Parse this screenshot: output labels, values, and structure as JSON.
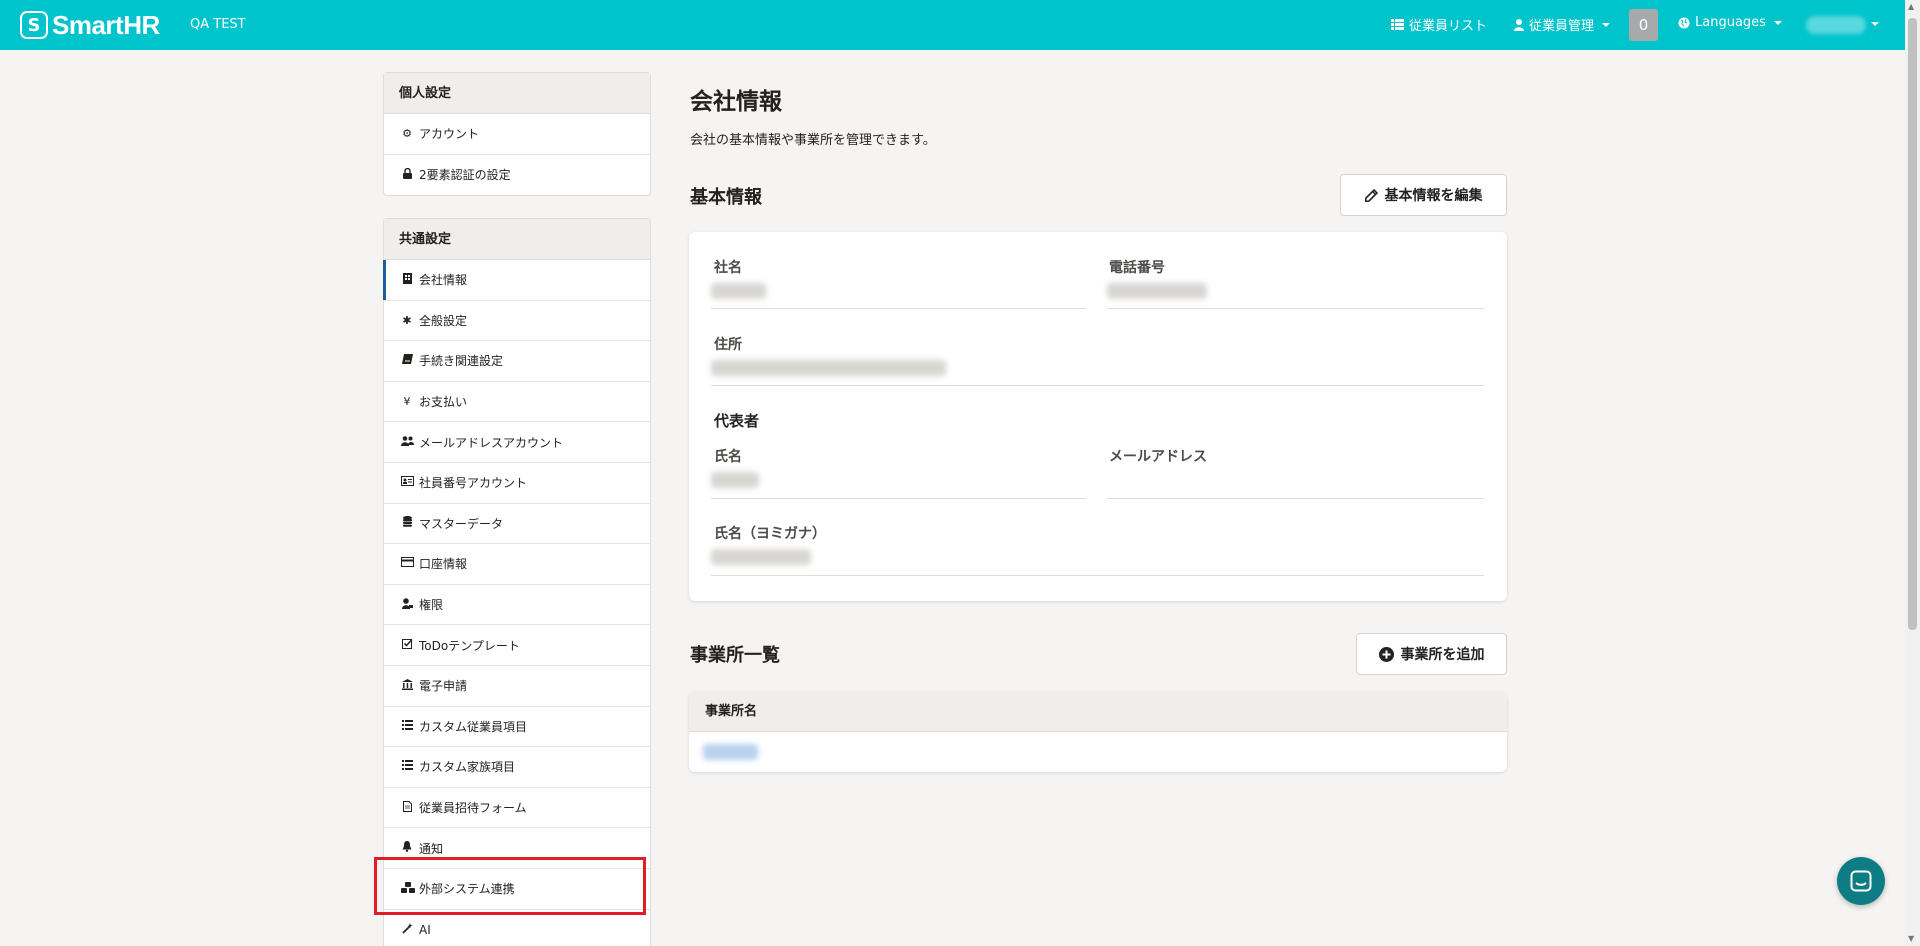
{
  "header": {
    "logo_text": "SmartHR",
    "logo_mark": "S",
    "tenant": "QA TEST",
    "nav": {
      "employee_list": "従業員リスト",
      "employee_manage": "従業員管理",
      "notifications_count": "0",
      "languages": "Languages"
    }
  },
  "sidebar": {
    "personal": {
      "title": "個人設定",
      "items": [
        {
          "label": "アカウント",
          "icon": "gear-icon"
        },
        {
          "label": "2要素認証の設定",
          "icon": "lock-icon"
        }
      ]
    },
    "common": {
      "title": "共通設定",
      "items": [
        {
          "label": "会社情報",
          "icon": "building-icon"
        },
        {
          "label": "全般設定",
          "icon": "asterisk-icon"
        },
        {
          "label": "手続き関連設定",
          "icon": "book-icon"
        },
        {
          "label": "お支払い",
          "icon": "yen-icon"
        },
        {
          "label": "メールアドレスアカウント",
          "icon": "users-icon"
        },
        {
          "label": "社員番号アカウント",
          "icon": "id-card-icon"
        },
        {
          "label": "マスターデータ",
          "icon": "database-icon"
        },
        {
          "label": "口座情報",
          "icon": "credit-card-icon"
        },
        {
          "label": "権限",
          "icon": "user-lock-icon"
        },
        {
          "label": "ToDoテンプレート",
          "icon": "checkbox-icon"
        },
        {
          "label": "電子申請",
          "icon": "bank-icon"
        },
        {
          "label": "カスタム従業員項目",
          "icon": "list-icon"
        },
        {
          "label": "カスタム家族項目",
          "icon": "list-icon"
        },
        {
          "label": "従業員招待フォーム",
          "icon": "file-icon"
        },
        {
          "label": "通知",
          "icon": "bell-icon"
        },
        {
          "label": "外部システム連携",
          "icon": "cubes-icon"
        },
        {
          "label": "AI",
          "icon": "magic-wand-icon"
        }
      ]
    }
  },
  "main": {
    "title": "会社情報",
    "description": "会社の基本情報や事業所を管理できます。",
    "basic_info": {
      "title": "基本情報",
      "edit_button": "基本情報を編集",
      "company_name_label": "社名",
      "phone_label": "電話番号",
      "address_label": "住所",
      "representative_title": "代表者",
      "rep_name_label": "氏名",
      "rep_email_label": "メールアドレス",
      "rep_kana_label": "氏名（ヨミガナ）"
    },
    "offices": {
      "title": "事業所一覧",
      "add_button": "事業所を追加",
      "column_header": "事業所名"
    }
  }
}
